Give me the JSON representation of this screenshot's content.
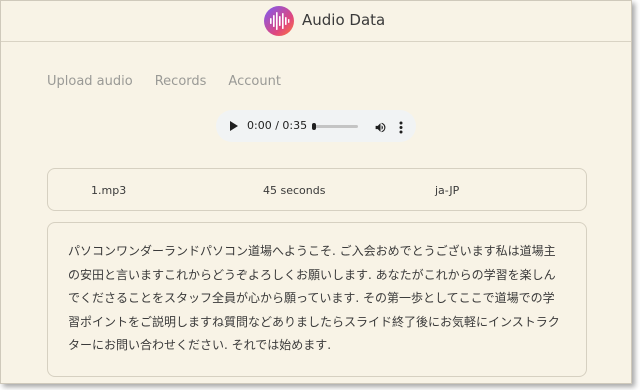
{
  "header": {
    "app_title": "Audio Data",
    "logo_icon": "audio-waveform-icon"
  },
  "nav": {
    "items": [
      {
        "label": "Upload audio"
      },
      {
        "label": "Records"
      },
      {
        "label": "Account"
      }
    ]
  },
  "player": {
    "time_display": "0:00 / 0:35",
    "progress": 0,
    "icons": {
      "play": "play-icon",
      "volume": "volume-icon",
      "more": "more-vertical-icon"
    }
  },
  "record": {
    "file_name": "1.mp3",
    "duration": "45 seconds",
    "language": "ja-JP"
  },
  "transcript": {
    "text": "パソコンワンダーランドパソコン道場へようこそ. ご入会おめでとうございます私は道場主の安田と言いますこれからどうぞよろしくお願いします. あなたがこれからの学習を楽しんでくださることをスタッフ全員が心から願っています. その第一歩としてここで道場での学習ポイントをご説明しますね質問などありましたらスライド終了後にお気軽にインストラクターにお問い合わせください. それでは始めます."
  }
}
